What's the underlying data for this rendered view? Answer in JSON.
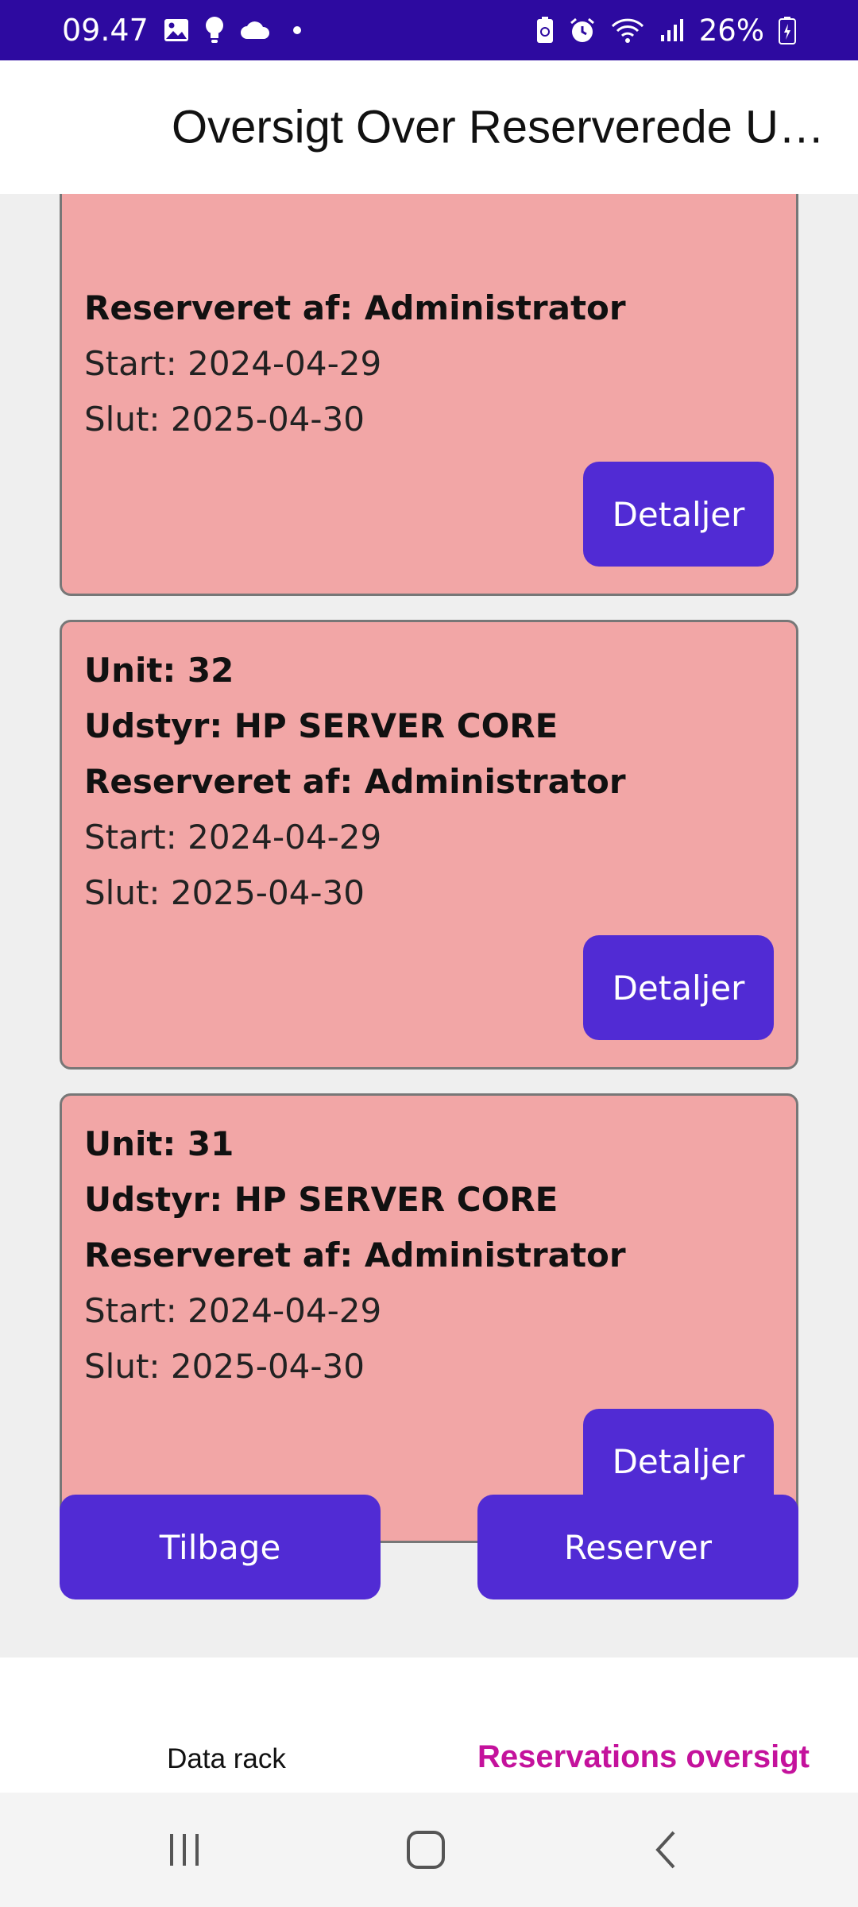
{
  "status_bar": {
    "time": "09.47",
    "battery": "26%",
    "left_icons": [
      "image-icon",
      "bulb-icon",
      "cloud-icon",
      "dot-icon"
    ],
    "right_icons": [
      "battery-saver-icon",
      "alarm-icon",
      "wifi-icon",
      "signal-icon",
      "battery-icon"
    ],
    "background": "#2d0aa0"
  },
  "header": {
    "title": "Oversigt Over Reserverede Units"
  },
  "cards": [
    {
      "unit": "",
      "equipment": "",
      "reserved_by": "Reserveret af: Administrator",
      "start": "Start: 2024-04-29",
      "end": "Slut: 2025-04-30",
      "button_label": "Detaljer"
    },
    {
      "unit": "Unit: 32",
      "equipment": "Udstyr: HP SERVER CORE",
      "reserved_by": "Reserveret af: Administrator",
      "start": "Start: 2024-04-29",
      "end": "Slut: 2025-04-30",
      "button_label": "Detaljer"
    },
    {
      "unit": "Unit: 31",
      "equipment": "Udstyr: HP SERVER CORE",
      "reserved_by": "Reserveret af: Administrator",
      "start": "Start: 2024-04-29",
      "end": "Slut: 2025-04-30",
      "button_label": "Detaljer"
    }
  ],
  "actions": {
    "back_label": "Tilbage",
    "reserve_label": "Reserver"
  },
  "tabs": [
    {
      "label": "Data rack",
      "active": false
    },
    {
      "label": "Reservations oversigt",
      "active": true
    }
  ],
  "colors": {
    "card_background": "#f2a6a6",
    "button": "#512bd4",
    "active_tab": "#c4129c"
  },
  "system_nav": {
    "icons": [
      "recent-apps-icon",
      "home-icon",
      "back-icon"
    ]
  }
}
